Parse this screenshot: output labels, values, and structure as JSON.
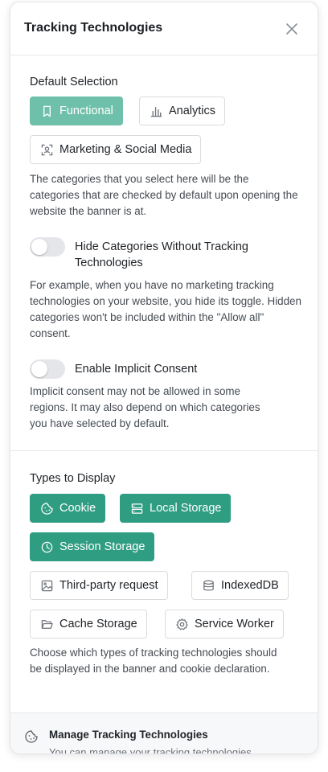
{
  "header": {
    "title": "Tracking Technologies",
    "close_icon": "close-icon"
  },
  "default_selection": {
    "label": "Default Selection",
    "chips": [
      {
        "label": "Functional",
        "icon": "bookmark-icon",
        "selected": true
      },
      {
        "label": "Analytics",
        "icon": "bar-chart-icon",
        "selected": false
      },
      {
        "label": "Marketing & Social Media",
        "icon": "scan-user-icon",
        "selected": false
      }
    ],
    "description": "The categories that you select here will be the categories that are checked by default upon opening the website the banner is at."
  },
  "hide_categories": {
    "label": "Hide Categories Without Tracking Technologies",
    "enabled": false,
    "description": "For example, when you have no marketing tracking technologies on your website, you hide its toggle. Hidden categories won't be included within the \"Allow all\" consent."
  },
  "implicit_consent": {
    "label": "Enable Implicit Consent",
    "enabled": false,
    "description": "Implicit consent may not be allowed in some regions. It may also depend on which categories you have selected by default."
  },
  "types_to_display": {
    "label": "Types to Display",
    "chips": [
      {
        "label": "Cookie",
        "icon": "cookie-icon",
        "selected": true
      },
      {
        "label": "Local Storage",
        "icon": "server-icon",
        "selected": true
      },
      {
        "label": "Session Storage",
        "icon": "pie-clock-icon",
        "selected": true
      },
      {
        "label": "Third-party request",
        "icon": "image-icon",
        "selected": false
      },
      {
        "label": "IndexedDB",
        "icon": "database-icon",
        "selected": false
      },
      {
        "label": "Cache Storage",
        "icon": "folder-open-icon",
        "selected": false
      },
      {
        "label": "Service Worker",
        "icon": "gear-icon",
        "selected": false
      }
    ],
    "description": "Choose which types of tracking technologies should be displayed in the banner and cookie declaration."
  },
  "footer": {
    "title": "Manage Tracking Technologies",
    "description": "You can manage your tracking technologies",
    "icon": "cookie-icon"
  },
  "colors": {
    "accent": "#2f9d82",
    "accent_light": "#6fc0aa",
    "border": "#d9dcdf"
  }
}
